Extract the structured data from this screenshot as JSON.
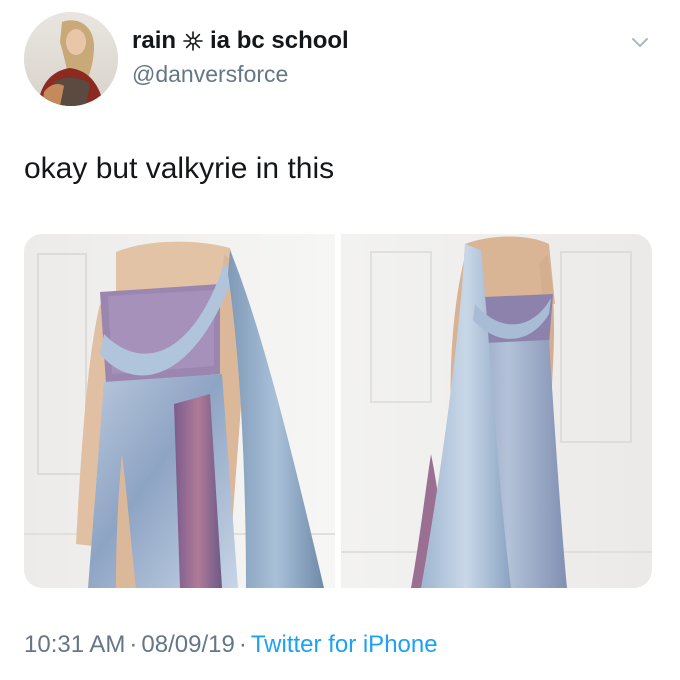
{
  "user": {
    "name_part1": "rain",
    "name_part2": "ia bc school",
    "handle": "@danversforce",
    "name_icon": "sparkle-icon"
  },
  "tweet": {
    "text": "okay but valkyrie in this"
  },
  "media": {
    "photos": [
      {
        "subject": "gown-front-view"
      },
      {
        "subject": "gown-back-view"
      }
    ]
  },
  "meta": {
    "time": "10:31 AM",
    "separator": "·",
    "date": "08/09/19",
    "source": "Twitter for iPhone"
  },
  "colors": {
    "text_primary": "#14171a",
    "text_secondary": "#657786",
    "link": "#1da1f2"
  },
  "icons": {
    "menu": "chevron-down-icon"
  }
}
